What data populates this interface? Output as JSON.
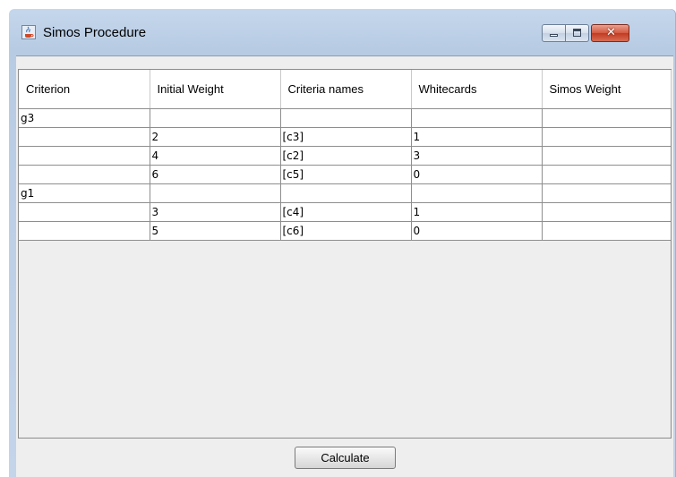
{
  "window": {
    "title": "Simos Procedure",
    "icon": "java-cup-icon",
    "controls": {
      "minimize_icon": "minimize-icon",
      "maximize_icon": "maximize-icon",
      "close_label": "✕"
    }
  },
  "table": {
    "columns": [
      "Criterion",
      "Initial Weight",
      "Criteria names",
      "Whitecards",
      "Simos Weight"
    ],
    "rows": [
      [
        "g3",
        "",
        "",
        "",
        ""
      ],
      [
        "",
        "2",
        "[c3]",
        "1",
        ""
      ],
      [
        "",
        "4",
        "[c2]",
        "3",
        ""
      ],
      [
        "",
        "6",
        "[c5]",
        "0",
        ""
      ],
      [
        "g1",
        "",
        "",
        "",
        ""
      ],
      [
        "",
        "3",
        "[c4]",
        "1",
        ""
      ],
      [
        "",
        "5",
        "[c6]",
        "0",
        ""
      ]
    ]
  },
  "actions": {
    "calculate_label": "Calculate"
  }
}
